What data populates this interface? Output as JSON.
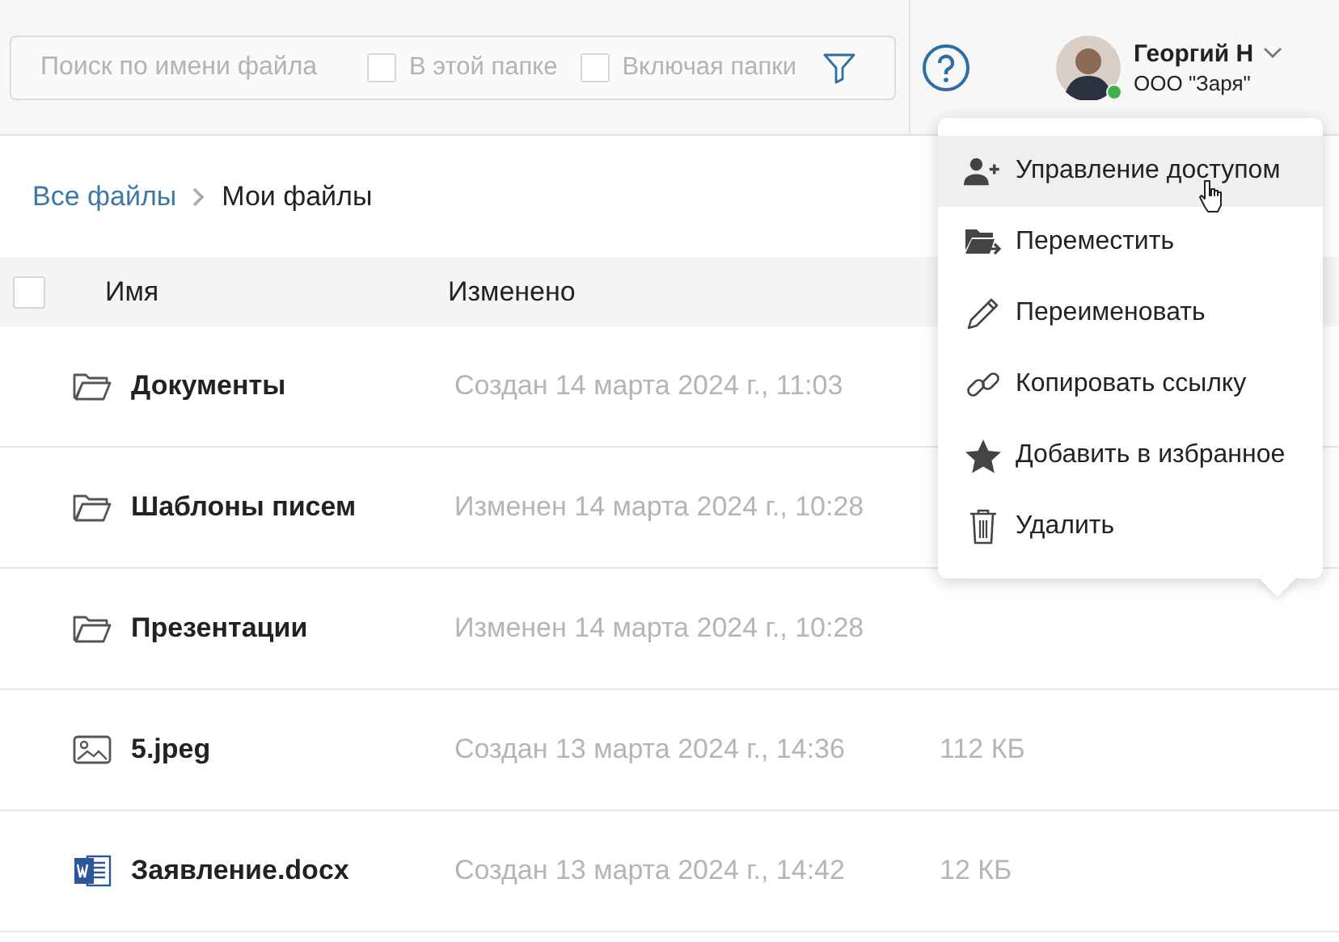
{
  "search": {
    "placeholder": "Поиск по имени файла",
    "options": [
      {
        "label": "В этой папке",
        "checked": false
      },
      {
        "label": "Включая папки",
        "checked": false
      }
    ]
  },
  "user": {
    "name": "Георгий Н",
    "company": "ООО \"Заря\"",
    "online": true
  },
  "breadcrumbs": [
    {
      "label": "Все файлы",
      "selected": false
    },
    {
      "label": "Мои файлы",
      "selected": true
    }
  ],
  "table": {
    "select_all": {
      "checked": false
    },
    "columns": [
      "Имя",
      "Изменено"
    ],
    "rows": [
      {
        "kind": "folder",
        "name": "Документы",
        "modified": "Создан 14 марта 2024 г., 11:03"
      },
      {
        "kind": "folder",
        "name": "Шаблоны писем",
        "modified": "Изменен 14 марта 2024 г., 10:28"
      },
      {
        "kind": "folder",
        "name": "Презентации",
        "modified": "Изменен 14 марта 2024 г., 10:28"
      },
      {
        "kind": "image",
        "name": "5.jpeg",
        "modified": "Создан 13 марта 2024 г., 14:36",
        "size": "112 КБ"
      },
      {
        "kind": "word",
        "name": "Заявление.docx",
        "modified": "Создан 13 марта 2024 г., 14:42",
        "size": "12 КБ"
      }
    ]
  },
  "context_menu": {
    "items": [
      {
        "kind": "access",
        "label": "Управление доступом",
        "selected": true
      },
      {
        "kind": "move",
        "label": "Переместить",
        "selected": false
      },
      {
        "kind": "rename",
        "label": "Переименовать",
        "selected": false
      },
      {
        "kind": "link",
        "label": "Копировать ссылку",
        "selected": false
      },
      {
        "kind": "favorite",
        "label": "Добавить в избранное",
        "selected": false
      },
      {
        "kind": "delete",
        "label": "Удалить",
        "selected": false
      }
    ]
  }
}
